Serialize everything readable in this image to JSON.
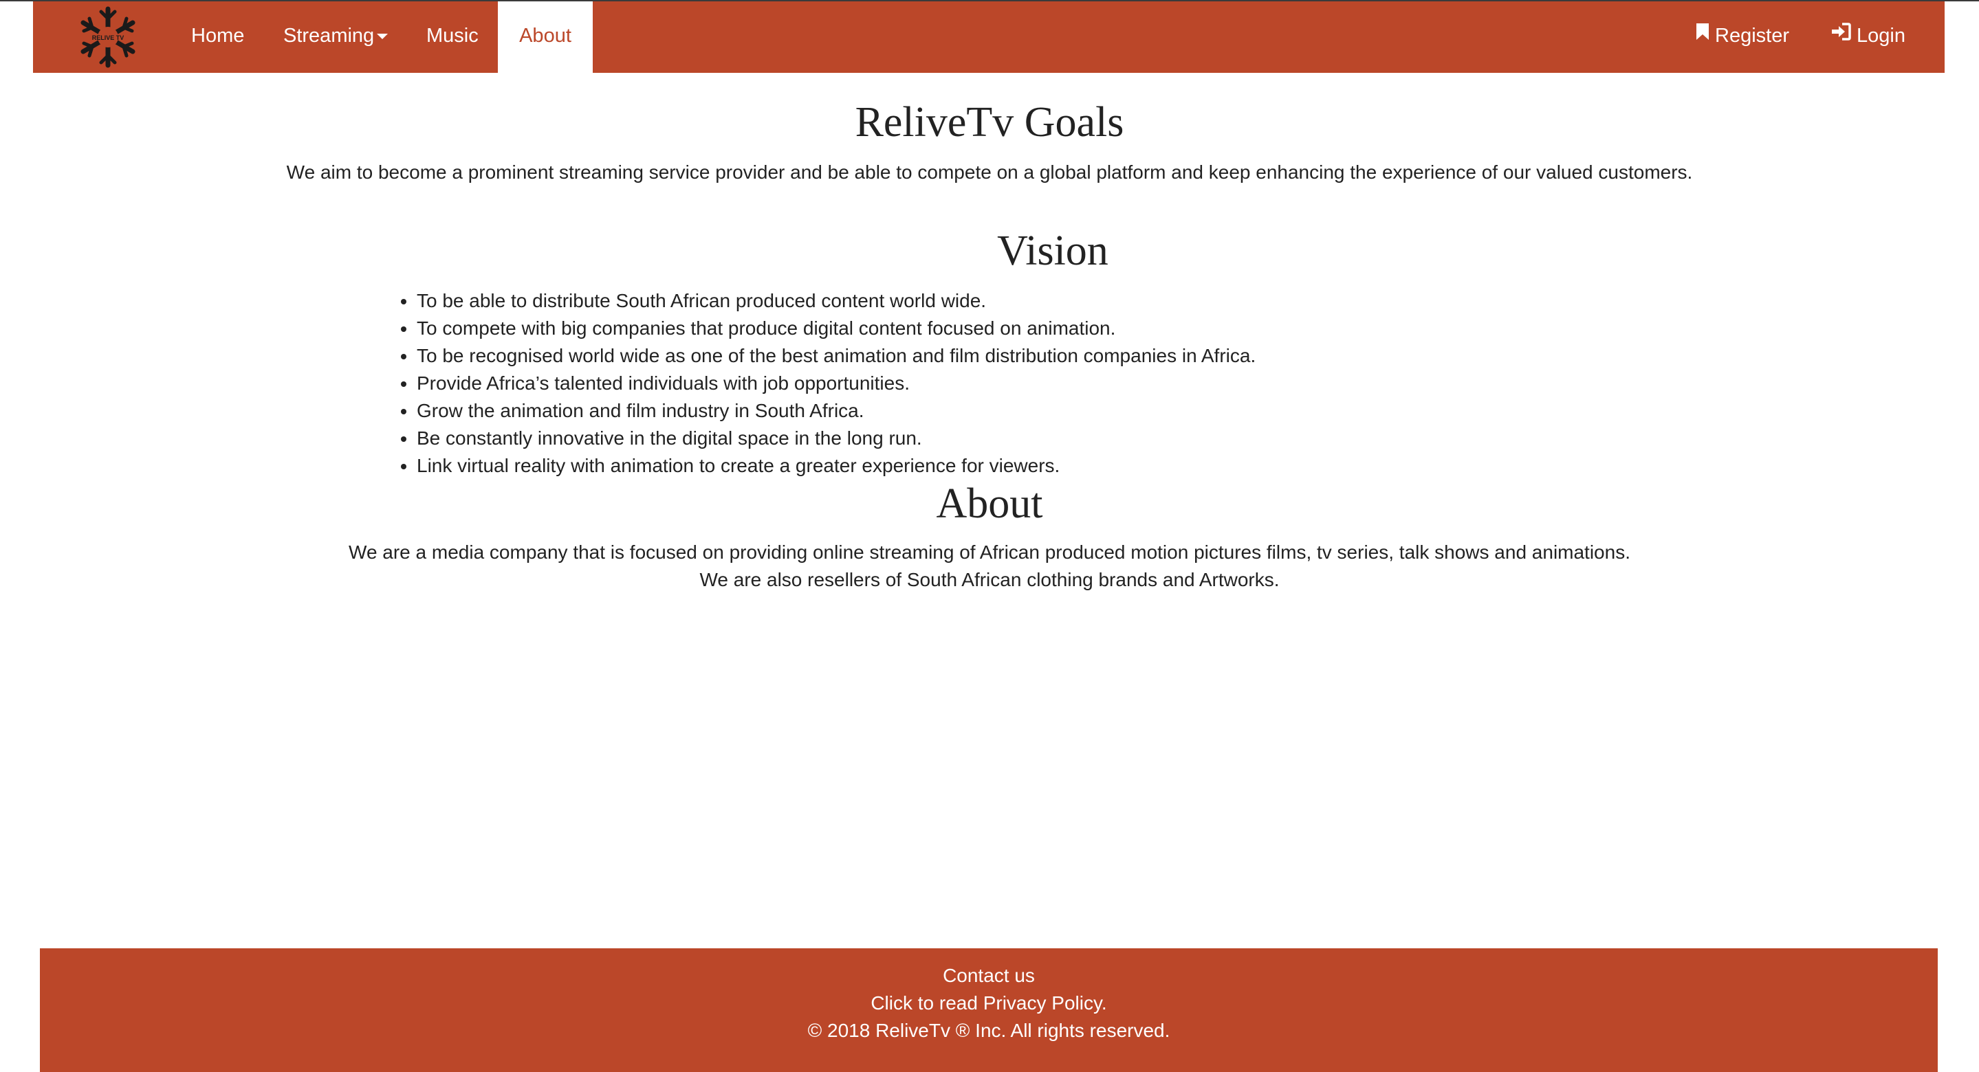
{
  "colors": {
    "brand": "#bb4729",
    "text": "#222222",
    "nav_text": "#ffffff"
  },
  "nav": {
    "logo_text": "RELIVE TV",
    "items": [
      {
        "label": "Home"
      },
      {
        "label": "Streaming",
        "icon": "caret-down-icon"
      },
      {
        "label": "Music"
      },
      {
        "label": "About",
        "active": true
      }
    ],
    "register_label": "Register",
    "register_icon": "bookmark-icon",
    "login_label": "Login",
    "login_icon": "sign-in-icon"
  },
  "goals": {
    "title": "ReliveTv Goals",
    "text": "We aim to become a prominent streaming service provider and be able to compete on a global platform and keep enhancing the experience of our valued customers."
  },
  "vision": {
    "title": "Vision",
    "items": [
      "To be able to distribute South African produced content world wide.",
      "To compete with big companies that produce digital content focused on animation.",
      "To be recognised world wide as one of the best animation and film distribution companies in Africa.",
      "Provide Africa’s talented individuals with job opportunities.",
      "Grow the animation and film industry in South Africa.",
      "Be constantly innovative in the digital space in the long run.",
      "Link virtual reality with animation to create a greater experience for viewers."
    ]
  },
  "about": {
    "title": "About",
    "line1": "We are a media company that is focused on providing online streaming of African produced motion pictures films, tv series, talk shows and animations.",
    "line2": "We are also resellers of South African clothing brands and Artworks."
  },
  "footer": {
    "contact": "Contact us",
    "privacy": "Click to read Privacy Policy.",
    "copyright": "© 2018 ReliveTv ® Inc. All rights reserved."
  }
}
